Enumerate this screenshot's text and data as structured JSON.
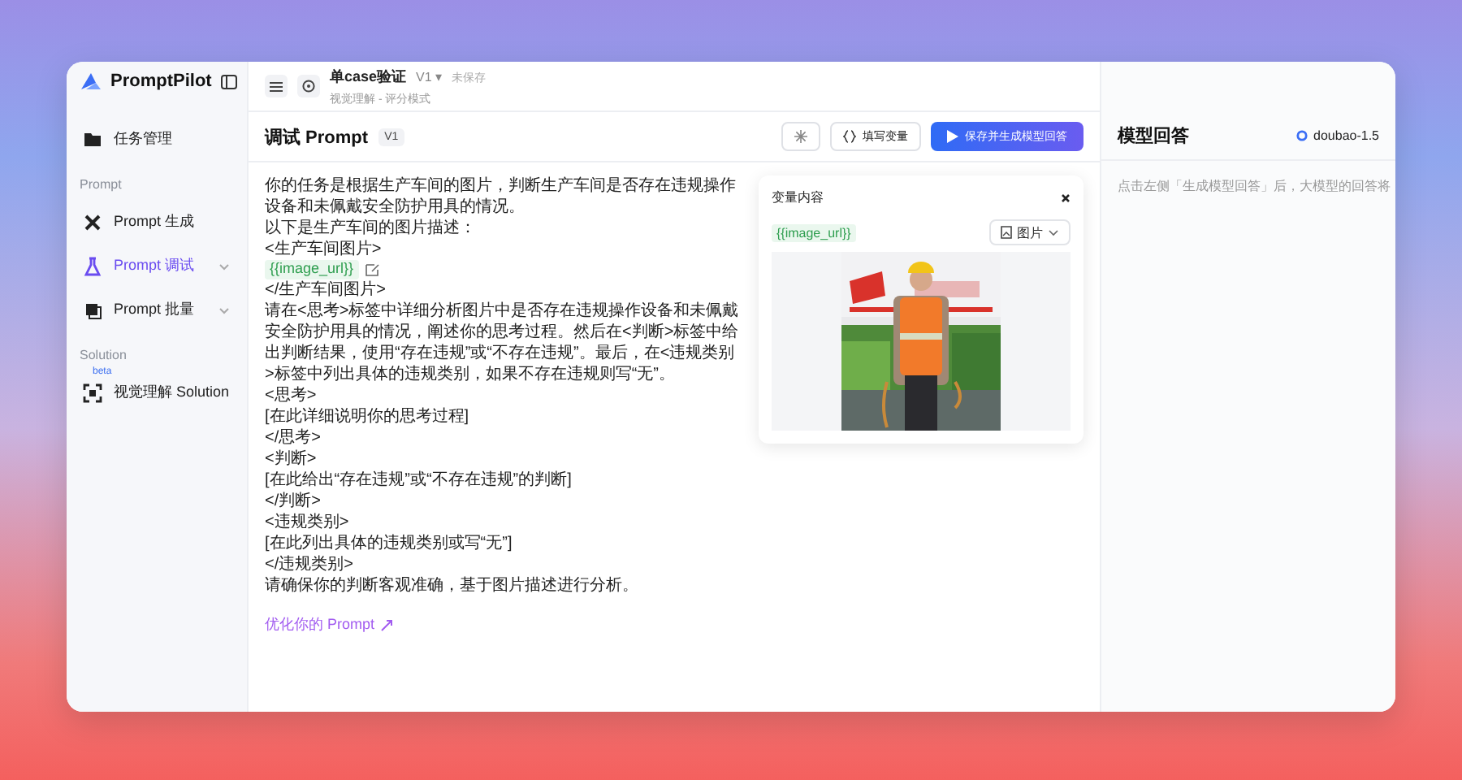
{
  "header": {
    "title": "单case验证",
    "version": "V1 ▾",
    "save_state": "未保存",
    "subtitle": "视觉理解 - 评分模式"
  },
  "sidebar": {
    "brand": "PromptPilot",
    "items": [
      {
        "kind": "item",
        "label": "任务管理",
        "selected": false,
        "expandable": false
      },
      {
        "kind": "section",
        "label": "Prompt"
      },
      {
        "kind": "item",
        "label": "Prompt 生成",
        "selected": false,
        "expandable": false
      },
      {
        "kind": "item",
        "label": "Prompt 调试",
        "selected": true,
        "expandable": true
      },
      {
        "kind": "item",
        "label": "Prompt 批量",
        "selected": false,
        "expandable": true
      },
      {
        "kind": "section",
        "label": "Solution"
      },
      {
        "kind": "item",
        "label": "视觉理解 Solution",
        "badge": "beta",
        "selected": false,
        "expandable": false
      }
    ]
  },
  "editor": {
    "title": "调试 Prompt",
    "version": "V1",
    "fill_button": "填写变量",
    "run_button": "保存并生成模型回答",
    "lines": [
      {
        "kind": "text",
        "text": "你的任务是根据生产车间的图片，判断生产车间是否存在违规操作设备和未佩戴安全防护用具的情况。"
      },
      {
        "kind": "text",
        "text": "以下是生产车间的图片描述："
      },
      {
        "kind": "text",
        "text": "<生产车间图片>"
      },
      {
        "kind": "variable",
        "text": "{{image_url}}"
      },
      {
        "kind": "text",
        "text": "</生产车间图片>"
      },
      {
        "kind": "text",
        "text": "请在<思考>标签中详细分析图片中是否存在违规操作设备和未佩戴安全防护用具的情况，阐述你的思考过程。然后在<判断>标签中给出判断结果，使用“存在违规”或“不存在违规”。最后，在<违规类别>标签中列出具体的违规类别，如果不存在违规则写“无”。"
      },
      {
        "kind": "text",
        "text": "<思考>"
      },
      {
        "kind": "text",
        "text": "[在此详细说明你的思考过程]"
      },
      {
        "kind": "text",
        "text": "</思考>"
      },
      {
        "kind": "text",
        "text": "<判断>"
      },
      {
        "kind": "text",
        "text": "[在此给出“存在违规”或“不存在违规”的判断]"
      },
      {
        "kind": "text",
        "text": "</判断>"
      },
      {
        "kind": "text",
        "text": "<违规类别>"
      },
      {
        "kind": "text",
        "text": "[在此列出具体的违规类别或写“无”]"
      },
      {
        "kind": "text",
        "text": "</违规类别>"
      },
      {
        "kind": "text",
        "text": "请确保你的判断客观准确，基于图片描述进行分析。"
      }
    ],
    "optimize_link": "优化你的 Prompt"
  },
  "variables": {
    "title": "变量内容",
    "items": [
      {
        "name": "{{image_url}}",
        "type": "图片",
        "kind": "picture"
      }
    ]
  },
  "answer": {
    "title": "模型回答",
    "model": "doubao-1.5",
    "hint": "点击左侧「生成模型回答」后，大模型的回答将"
  }
}
